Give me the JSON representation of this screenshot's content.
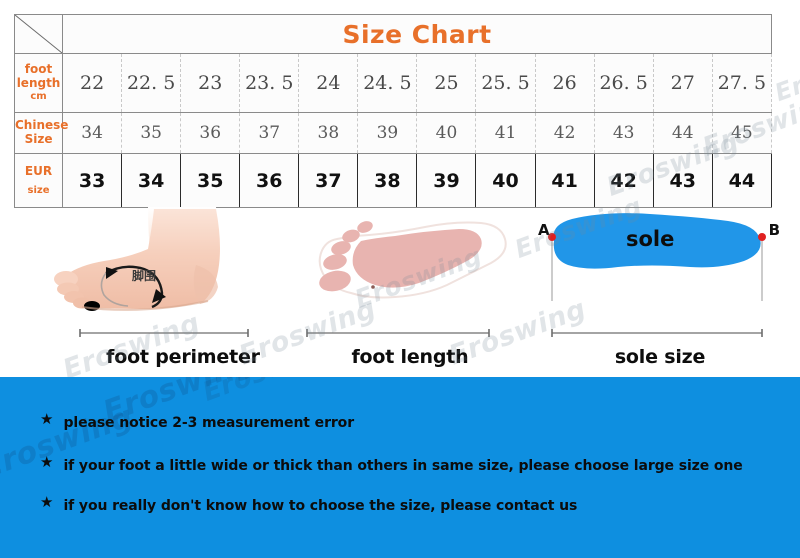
{
  "table": {
    "title": "Size Chart",
    "corner_icon": "diagonal-divider-icon",
    "rows": [
      {
        "key": "foot_length",
        "label_line1": "foot",
        "label_line2": "length",
        "label_line3": "cm",
        "values": [
          "22",
          "22. 5",
          "23",
          "23. 5",
          "24",
          "24. 5",
          "25",
          "25. 5",
          "26",
          "26. 5",
          "27",
          "27. 5"
        ]
      },
      {
        "key": "chinese_size",
        "label_line1": "Chinese",
        "label_line2": "Size",
        "label_line3": "",
        "values": [
          "34",
          "35",
          "36",
          "37",
          "38",
          "39",
          "40",
          "41",
          "42",
          "43",
          "44",
          "45"
        ]
      },
      {
        "key": "eur_size",
        "label_line1": "EUR",
        "label_line2": "size",
        "label_line3": "",
        "values": [
          "33",
          "34",
          "35",
          "36",
          "37",
          "38",
          "39",
          "40",
          "41",
          "42",
          "43",
          "44"
        ]
      }
    ]
  },
  "illustrations": [
    {
      "key": "foot_perimeter",
      "label": "foot perimeter",
      "art": "foot-photo-side-view",
      "annotation": "脚围"
    },
    {
      "key": "foot_length",
      "label": "foot length",
      "art": "pink-footprint"
    },
    {
      "key": "sole_size",
      "label": "sole size",
      "art": "blue-sole-shape",
      "inner_label": "sole",
      "point_a": "A",
      "point_b": "B"
    }
  ],
  "notices": {
    "bullet": "★",
    "items": [
      "please notice 2-3 measurement error",
      "if your foot a little wide or thick than others in same size, please choose large size one",
      "if you really don't know how to choose the size, please contact us"
    ]
  },
  "watermark": {
    "text": "Eroswing"
  },
  "colors": {
    "accent_orange": "#E8702A",
    "notice_blue": "#0E8FE0",
    "sole_blue": "#2196E8",
    "footprint_pink": "#E8B4B0",
    "point_red": "#E02020"
  }
}
